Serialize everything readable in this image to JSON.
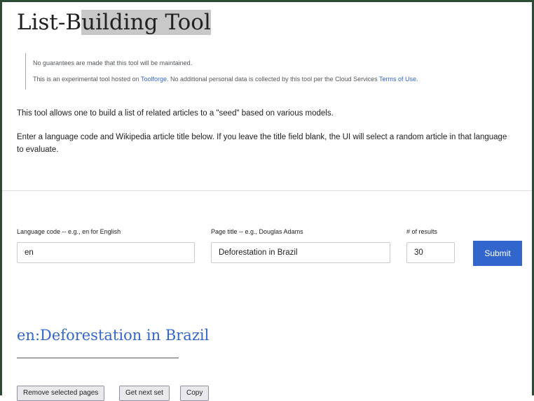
{
  "header": {
    "title_prefix": "List-B",
    "title_highlight": "uilding Tool"
  },
  "notice": {
    "line1": "No guarantees are made that this tool will be maintained.",
    "line2_before": "This is an experimental tool hosted on ",
    "line2_link": "Toolforge",
    "line2_middle": ". No additional personal data is collected by this tool per the Cloud Services ",
    "line2_link2": "Terms of Use",
    "line2_end": "."
  },
  "intro": {
    "p1": "This tool allows one to build a list of related articles to a \"seed\" based on various models.",
    "p2": "Enter a language code and Wikipedia article title below. If you leave the title field blank, the UI will select a random article in that language to evaluate."
  },
  "form": {
    "lang_label": "Language code -- e.g., en for English",
    "lang_value": "en",
    "title_label": "Page title -- e.g., Douglas Adams",
    "title_value": "Deforestation in Brazil",
    "num_label": "# of results",
    "num_value": "30",
    "submit_label": "Submit"
  },
  "result": {
    "heading": "en:Deforestation in Brazil"
  },
  "actions": {
    "remove_label": "Remove selected pages",
    "next_label": "Get next set",
    "copy_label": "Copy"
  },
  "colors": {
    "accent": "#3366cc",
    "frame": "#2d4a35"
  }
}
